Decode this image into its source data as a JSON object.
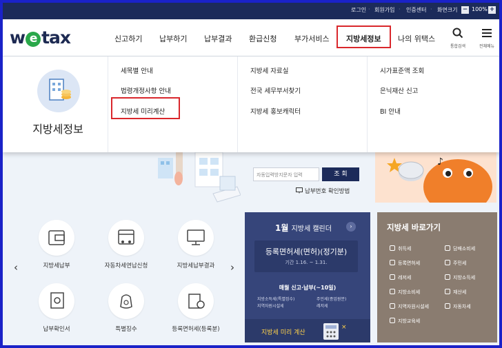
{
  "topbar": {
    "login": "로그인",
    "signup": "회원가입",
    "cert": "인증센터",
    "zoom_label": "화면크기",
    "zoom_minus": "−",
    "zoom_value": "100%",
    "zoom_plus": "+"
  },
  "header": {
    "logo_w": "w",
    "logo_e": "e",
    "logo_rest": "tax",
    "nav": [
      "신고하기",
      "납부하기",
      "납부결과",
      "환급신청",
      "부가서비스",
      "지방세정보",
      "나의 위택스"
    ],
    "search_caption": "통합검색",
    "menu_caption": "전체메뉴"
  },
  "mega": {
    "section_title": "지방세정보",
    "col1": [
      "세목별 안내",
      "법령개정사항 안내",
      "지방세 미리계산"
    ],
    "col2": [
      "지방세 자료실",
      "전국 세무부서찾기",
      "지방세 홍보캐릭터"
    ],
    "col3": [
      "시가표준액 조회",
      "은닉재산 신고",
      "BI 안내"
    ]
  },
  "login": {
    "input_placeholder": "자동입력방지문자 입력",
    "button": "조 회",
    "pay_link": "납부번호 확인방법"
  },
  "quick": [
    {
      "label": "지방세납부"
    },
    {
      "label": "자동차세연납신청"
    },
    {
      "label": "지방세납부결과"
    },
    {
      "label": "납부확인서"
    },
    {
      "label": "특별징수"
    },
    {
      "label": "등록면허세(등록분)"
    }
  ],
  "calendar": {
    "month": "1월",
    "title": "지방세 캘린더",
    "main_item": "등록면허세(면허)(정기분)",
    "period": "기간 1.16. ~ 1.31.",
    "monthly": "매월 신고·납부(~10일)",
    "taxes": [
      "지방소득세(특별징수)",
      "주민세(종업원분)",
      "지역자원시설세",
      "레저세"
    ],
    "footer": "지방세 미리 계산"
  },
  "shortcut": {
    "title": "지방세 바로가기",
    "items": [
      "취득세",
      "담배소비세",
      "등록면허세",
      "주민세",
      "레저세",
      "지방소득세",
      "지방소비세",
      "재산세",
      "지역자원시설세",
      "자동차세",
      "지방교육세"
    ]
  },
  "colors": {
    "navy": "#1c2b5a",
    "highlight": "#d9262b",
    "logo_green": "#2aa84a",
    "shortcut_bg": "#8a7c70"
  }
}
